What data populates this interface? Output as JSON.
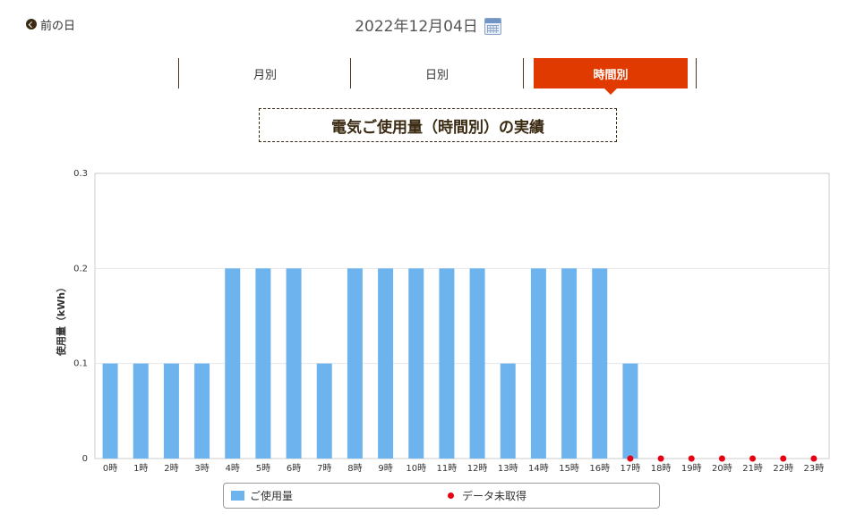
{
  "nav": {
    "prev_label": "前の日",
    "date": "2022年12月04日",
    "calendar_icon": "calendar-icon"
  },
  "tabs": [
    {
      "label": "月別",
      "active": false
    },
    {
      "label": "日別",
      "active": false
    },
    {
      "label": "時間別",
      "active": true
    }
  ],
  "colors": {
    "accent": "#e13a00",
    "bar": "#6db4ee",
    "missing": "#e60012"
  },
  "chart_data": {
    "type": "bar",
    "title": "電気ご使用量（時間別）の実績",
    "ylabel": "使用量（kWh）",
    "xlabel": "",
    "ylim": [
      0,
      0.3
    ],
    "yticks": [
      "0",
      "0.1",
      "0.2",
      "0.3"
    ],
    "grid": true,
    "legend_position": "bottom",
    "categories": [
      "0時",
      "1時",
      "2時",
      "3時",
      "4時",
      "5時",
      "6時",
      "7時",
      "8時",
      "9時",
      "10時",
      "11時",
      "12時",
      "13時",
      "14時",
      "15時",
      "16時",
      "17時",
      "18時",
      "19時",
      "20時",
      "21時",
      "22時",
      "23時"
    ],
    "series": [
      {
        "name": "ご使用量",
        "values": [
          0.1,
          0.1,
          0.1,
          0.1,
          0.2,
          0.2,
          0.2,
          0.1,
          0.2,
          0.2,
          0.2,
          0.2,
          0.2,
          0.1,
          0.2,
          0.2,
          0.2,
          0.1,
          null,
          null,
          null,
          null,
          null,
          null
        ]
      },
      {
        "name": "データ未取得",
        "values": [
          null,
          null,
          null,
          null,
          null,
          null,
          null,
          null,
          null,
          null,
          null,
          null,
          null,
          null,
          null,
          null,
          null,
          0,
          0,
          0,
          0,
          0,
          0,
          0
        ]
      }
    ]
  }
}
